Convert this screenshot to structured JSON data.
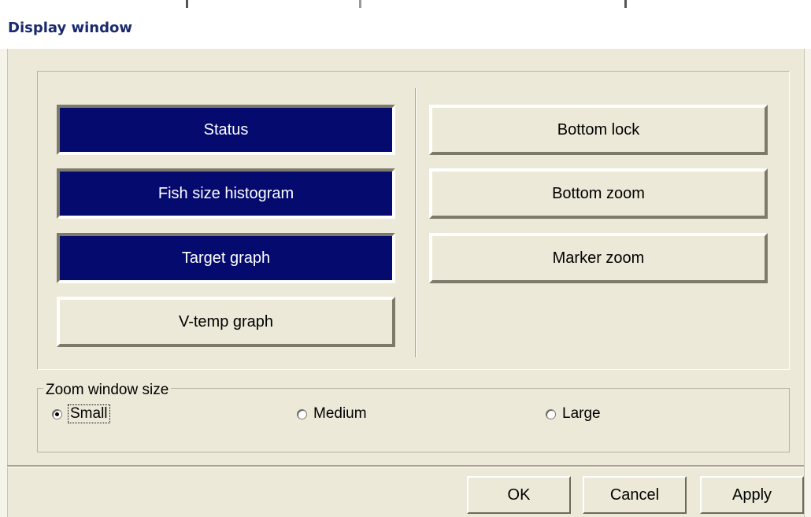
{
  "window": {
    "title": "Display window"
  },
  "display_buttons": {
    "status": {
      "label": "Status",
      "active": true
    },
    "fish_size_histogram": {
      "label": "Fish size histogram",
      "active": true
    },
    "target_graph": {
      "label": "Target graph",
      "active": true
    },
    "v_temp_graph": {
      "label": "V-temp graph",
      "active": false
    },
    "bottom_lock": {
      "label": "Bottom lock",
      "active": false
    },
    "bottom_zoom": {
      "label": "Bottom zoom",
      "active": false
    },
    "marker_zoom": {
      "label": "Marker zoom",
      "active": false
    }
  },
  "zoom_window_size": {
    "label": "Zoom window size",
    "options": [
      {
        "label": "Small",
        "checked": true
      },
      {
        "label": "Medium",
        "checked": false
      },
      {
        "label": "Large",
        "checked": false
      }
    ]
  },
  "dialog_buttons": {
    "ok": "OK",
    "cancel": "Cancel",
    "apply": "Apply"
  },
  "colors": {
    "active_button": "#040a6e",
    "dialog_bg": "#ece9d8",
    "title_text": "#1a2a6e"
  }
}
